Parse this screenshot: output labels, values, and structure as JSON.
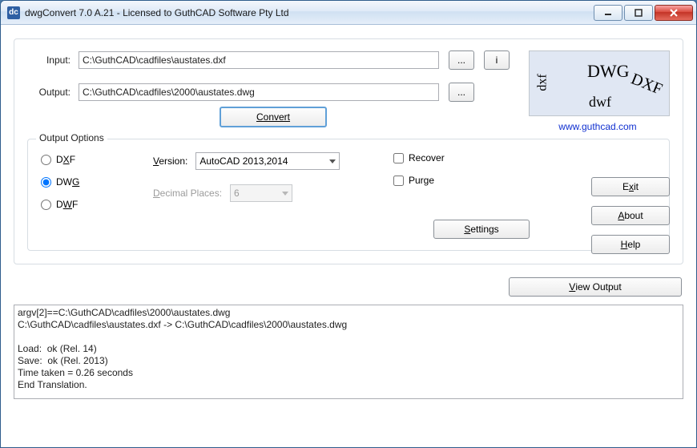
{
  "titlebar": {
    "icon": "dc",
    "title": "dwgConvert 7.0 A.21 - Licensed to GuthCAD Software Pty Ltd"
  },
  "labels": {
    "input": "Input:",
    "output": "Output:",
    "browse": "...",
    "info": "i",
    "convert": "Convert",
    "output_options": "Output Options",
    "dxf": "DXF",
    "dwg": "DWG",
    "dwf": "DWF",
    "version": "Version:",
    "decimal_places": "Decimal Places:",
    "recover": "Recover",
    "purge": "Purge",
    "settings": "Settings",
    "exit": "Exit",
    "about": "About",
    "help": "Help",
    "view_output": "View Output",
    "link": "www.guthcad.com"
  },
  "values": {
    "input_path": "C:\\GuthCAD\\cadfiles\\austates.dxf",
    "output_path": "C:\\GuthCAD\\cadfiles\\2000\\austates.dwg",
    "version_selected": "AutoCAD 2013,2014",
    "decimal_places": "6",
    "selected_format": "DWG",
    "recover_checked": false,
    "purge_checked": false
  },
  "logo": {
    "dwg": "DWG",
    "dxf": "DXF",
    "dxf2": "dxf",
    "dwf": "dwf"
  },
  "log_text": "argv[2]==C:\\GuthCAD\\cadfiles\\2000\\austates.dwg\nC:\\GuthCAD\\cadfiles\\austates.dxf -> C:\\GuthCAD\\cadfiles\\2000\\austates.dwg\n\nLoad:  ok (Rel. 14)\nSave:  ok (Rel. 2013)\nTime taken = 0.26 seconds\nEnd Translation."
}
